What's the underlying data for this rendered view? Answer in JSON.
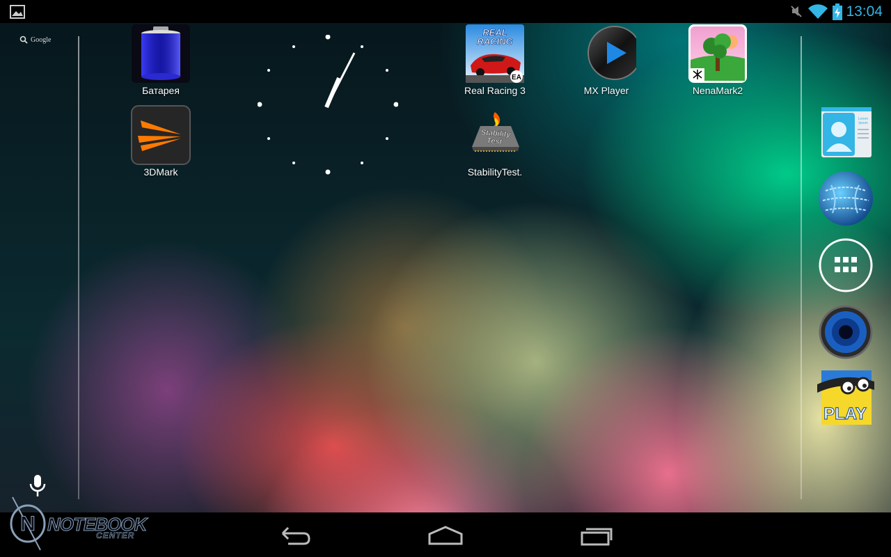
{
  "status_bar": {
    "time": "13:04",
    "icons": [
      "gallery-notification-icon",
      "mute-icon",
      "wifi-icon",
      "battery-charging-icon"
    ],
    "accent_color": "#33b5e5"
  },
  "search": {
    "label": "Google"
  },
  "apps": [
    {
      "label": "Батарея",
      "icon": "battery-app-icon"
    },
    {
      "label": "3DMark",
      "icon": "3dmark-icon"
    },
    {
      "label": "Real Racing 3",
      "icon": "real-racing-icon",
      "icon_text": "REAL RACING",
      "badge": "EA"
    },
    {
      "label": "StabilityTest.",
      "icon": "stability-test-icon",
      "icon_text": "Stability Test"
    },
    {
      "label": "MX Player",
      "icon": "mx-player-icon"
    },
    {
      "label": "NenaMark2",
      "icon": "nenamark-icon"
    }
  ],
  "dock": [
    {
      "name": "contacts-icon",
      "icon_text": "Lorem Ipsum"
    },
    {
      "name": "browser-globe-icon"
    },
    {
      "name": "all-apps-icon"
    },
    {
      "name": "music-speaker-icon"
    },
    {
      "name": "play-store-icon",
      "icon_text": "PLAY"
    }
  ],
  "nav": [
    "back-icon",
    "home-icon",
    "recent-apps-icon"
  ],
  "watermark": {
    "brand": "NOTEBOOK",
    "sub": "CENTER",
    "letter": "N"
  }
}
